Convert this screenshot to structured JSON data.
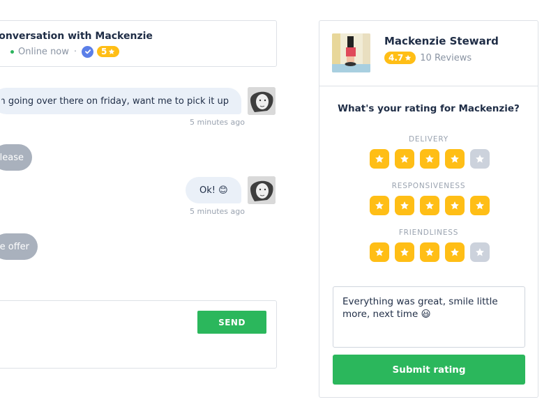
{
  "chat": {
    "title": "Conversation with Mackenzie",
    "status": "Online now",
    "badge": "5"
  },
  "messages": [
    {
      "text": "I think I'll buy it. Anyway im going over there on friday, want me to pick it up?",
      "time": "5 minutes ago"
    },
    {
      "text": "Yes, please."
    },
    {
      "text": "Ok! 😊",
      "time": "5 minutes ago"
    },
    {
      "text": "Thanks for the offer :)"
    }
  ],
  "composer": {
    "send_label": "SEND"
  },
  "profile": {
    "name": "Mackenzie Steward",
    "rating": "4.7",
    "reviews": "10 Reviews"
  },
  "rating": {
    "question": "What's your rating for Mackenzie?",
    "categories": [
      {
        "label": "DELIVERY",
        "stars": 4
      },
      {
        "label": "RESPONSIVENESS",
        "stars": 5
      },
      {
        "label": "FRIENDLINESS",
        "stars": 4
      }
    ],
    "review_text": "Everything was great, smile little more, next time 😃",
    "submit_label": "Submit rating"
  },
  "colors": {
    "accent_green": "#2bb75c",
    "star_yellow": "#ffbe16",
    "star_off": "#ccd2dc",
    "verified_blue": "#5b7fe8"
  }
}
